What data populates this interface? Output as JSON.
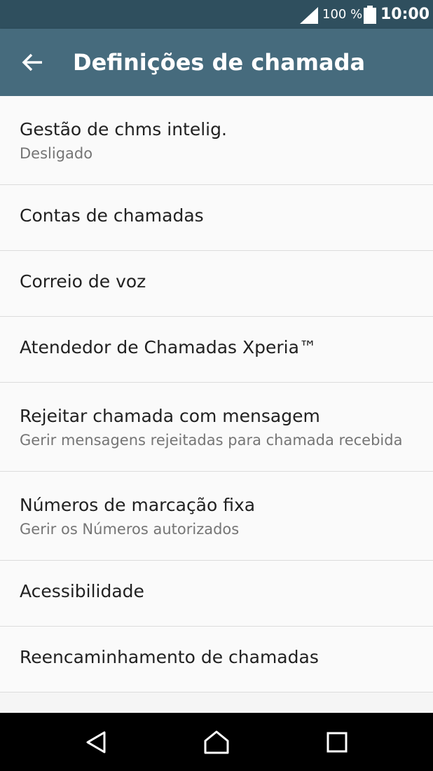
{
  "status_bar": {
    "battery_percent": "100 %",
    "time": "10:00",
    "icons": [
      "signal-icon",
      "battery-icon"
    ]
  },
  "app_bar": {
    "title": "Definições de chamada",
    "back_icon": "back-arrow-icon"
  },
  "settings": [
    {
      "label": "Gestão de chms intelig.",
      "sublabel": "Desligado"
    },
    {
      "label": "Contas de chamadas"
    },
    {
      "label": "Correio de voz"
    },
    {
      "label": "Atendedor de Chamadas Xperia™"
    },
    {
      "label": "Rejeitar chamada com mensagem",
      "sublabel": "Gerir mensagens rejeitadas para chamada recebida"
    },
    {
      "label": "Números de marcação fixa",
      "sublabel": "Gerir os Números autorizados"
    },
    {
      "label": "Acessibilidade"
    },
    {
      "label": "Reencaminhamento de chamadas"
    }
  ],
  "nav_bar": {
    "icons": [
      "back-triangle-icon",
      "home-icon",
      "recents-square-icon"
    ]
  },
  "colors": {
    "status_bar": "#2f4f5e",
    "app_bar": "#466b7d",
    "background": "#fafafa",
    "nav_bar": "#000000"
  }
}
